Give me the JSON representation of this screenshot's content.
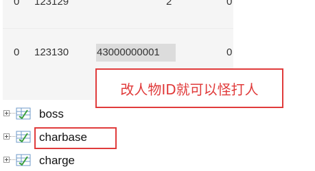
{
  "grid": {
    "rows": [
      {
        "col1": "0",
        "col2": "123129",
        "col3": "2",
        "col4": "0"
      },
      {
        "col1": "0",
        "col2": "123130",
        "col3": "43000000001",
        "col4": "0"
      }
    ]
  },
  "annotation": {
    "text": "改人物ID就可以怪打人",
    "color": "#e03a3a"
  },
  "tree": {
    "items": [
      {
        "label": "boss",
        "icon": "table-icon"
      },
      {
        "label": "charbase",
        "icon": "table-icon"
      },
      {
        "label": "charge",
        "icon": "table-icon"
      }
    ]
  }
}
